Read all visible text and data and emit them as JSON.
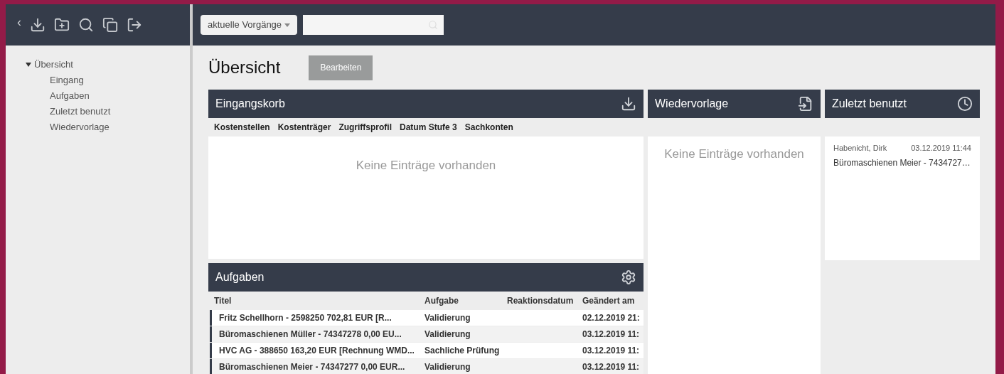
{
  "toolbar": {
    "back": "‹",
    "scope_dropdown": "aktuelle Vorgänge"
  },
  "sidebar": {
    "items": [
      {
        "label": "Übersicht",
        "expanded": true,
        "children": [
          {
            "label": "Eingang"
          },
          {
            "label": "Aufgaben"
          },
          {
            "label": "Zuletzt benutzt"
          },
          {
            "label": "Wiedervorlage"
          }
        ]
      }
    ]
  },
  "page": {
    "title": "Übersicht",
    "edit_button": "Bearbeiten"
  },
  "inbox": {
    "title": "Eingangskorb",
    "filters": [
      "Kostenstellen",
      "Kostenträger",
      "Zugriffsprofil",
      "Datum Stufe 3",
      "Sachkonten"
    ],
    "empty": "Keine Einträge vorhanden"
  },
  "resubmission": {
    "title": "Wiedervorlage",
    "empty": "Keine Einträge vorhanden"
  },
  "recent": {
    "title": "Zuletzt benutzt",
    "items": [
      {
        "user": "Habenicht, Dirk",
        "date": "03.12.2019 11:44",
        "title": "Büromaschienen Meier - 7434727…"
      }
    ]
  },
  "tasks": {
    "title": "Aufgaben",
    "columns": [
      "Titel",
      "Aufgabe",
      "Reaktionsdatum",
      "Geändert am"
    ],
    "rows": [
      {
        "title": "Fritz Schellhorn - 2598250 702,81 EUR [R...",
        "task": "Validierung",
        "reaction": "",
        "changed": "02.12.2019 21:"
      },
      {
        "title": "Büromaschienen Müller - 74347278 0,00 EU...",
        "task": "Validierung",
        "reaction": "",
        "changed": "03.12.2019 11:"
      },
      {
        "title": "HVC AG - 388650 163,20 EUR [Rechnung WMD...",
        "task": "Sachliche Prüfung",
        "reaction": "",
        "changed": "03.12.2019 11:"
      },
      {
        "title": "Büromaschienen Meier - 74347277 0,00 EUR...",
        "task": "Validierung",
        "reaction": "",
        "changed": "03.12.2019 11:"
      }
    ]
  }
}
